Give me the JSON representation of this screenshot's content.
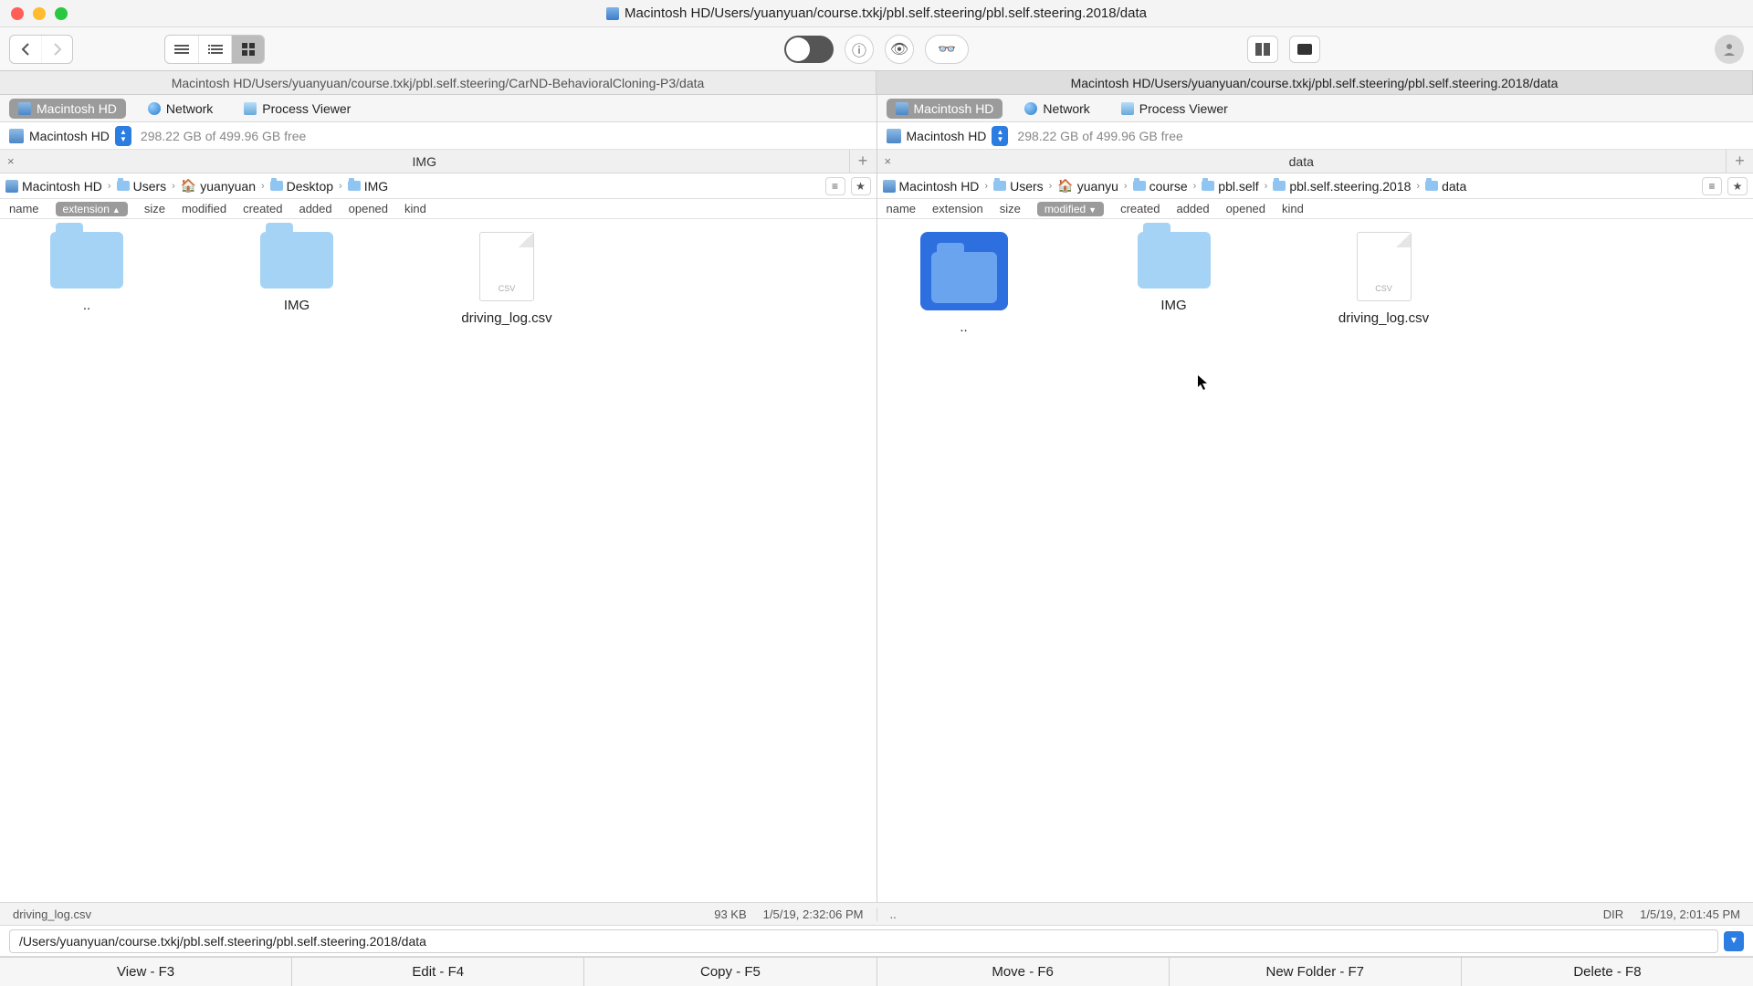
{
  "titlebar": {
    "path": "Macintosh HD/Users/yuanyuan/course.txkj/pbl.self.steering/pbl.self.steering.2018/data"
  },
  "top_tabs": {
    "left": "Macintosh HD/Users/yuanyuan/course.txkj/pbl.self.steering/CarND-BehavioralCloning-P3/data",
    "right": "Macintosh HD/Users/yuanyuan/course.txkj/pbl.self.steering/pbl.self.steering.2018/data"
  },
  "devices": {
    "hd": "Macintosh HD",
    "network": "Network",
    "process": "Process Viewer"
  },
  "drive": {
    "name": "Macintosh HD",
    "free": "298.22 GB of 499.96 GB free"
  },
  "left_pane": {
    "tab": "IMG",
    "crumbs": [
      "Macintosh HD",
      "Users",
      "yuanyuan",
      "Desktop",
      "IMG"
    ],
    "cols": [
      "name",
      "extension",
      "size",
      "modified",
      "created",
      "added",
      "opened",
      "kind"
    ],
    "sorted_col": "extension",
    "items": {
      "up": "..",
      "img": "IMG",
      "csv": "driving_log.csv"
    },
    "status": {
      "name": "driving_log.csv",
      "size": "93 KB",
      "date": "1/5/19, 2:32:06 PM"
    }
  },
  "right_pane": {
    "tab": "data",
    "crumbs": [
      "Macintosh HD",
      "Users",
      "yuanyu",
      "course",
      "pbl.self",
      "pbl.self.steering.2018",
      "data"
    ],
    "cols": [
      "name",
      "extension",
      "size",
      "modified",
      "created",
      "added",
      "opened",
      "kind"
    ],
    "sorted_col": "modified",
    "items": {
      "up": "..",
      "img": "IMG",
      "csv": "driving_log.csv"
    },
    "status": {
      "name": "..",
      "kind": "DIR",
      "date": "1/5/19, 2:01:45 PM"
    }
  },
  "path_field": "/Users/yuanyuan/course.txkj/pbl.self.steering/pbl.self.steering.2018/data",
  "bottom": {
    "view": "View - F3",
    "edit": "Edit - F4",
    "copy": "Copy - F5",
    "move": "Move - F6",
    "newfolder": "New Folder - F7",
    "delete": "Delete - F8"
  },
  "csv_badge": "CSV"
}
